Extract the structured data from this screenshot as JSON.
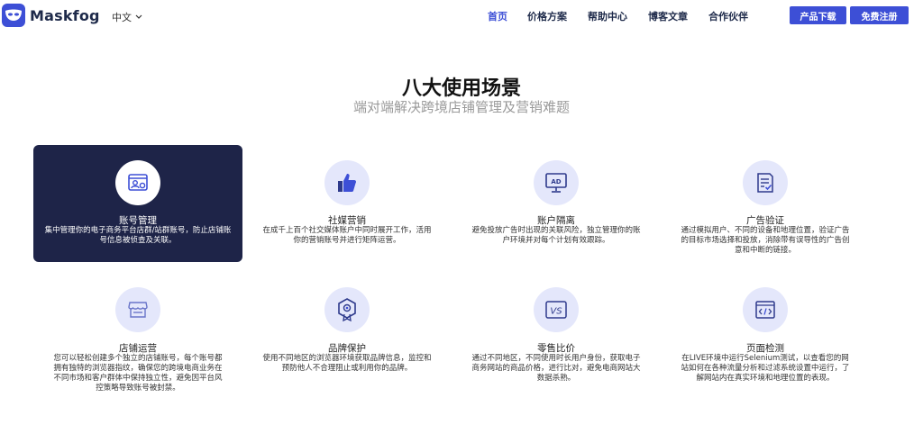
{
  "header": {
    "brand": "Maskfog",
    "language": "中文",
    "nav": [
      "首页",
      "价格方案",
      "帮助中心",
      "博客文章",
      "合作伙伴"
    ],
    "download_button": "产品下载",
    "register_button": "免费注册",
    "accent_color": "#3d4fd6"
  },
  "section": {
    "title": "八大使用场景",
    "subtitle": "端对端解决跨境店铺管理及营销难题"
  },
  "cards": [
    {
      "icon": "account-icon",
      "title": "账号管理",
      "desc": "集中管理你的电子商务平台店群/站群账号，防止店铺账号信息被侦查及关联。",
      "selected": true
    },
    {
      "icon": "thumbs-up-icon",
      "title": "社媒营销",
      "desc": "在成千上百个社交媒体账户中同时展开工作，活用你的营销账号并进行矩阵运营。",
      "selected": false
    },
    {
      "icon": "ad-monitor-icon",
      "title": "账户隔离",
      "desc": "避免投放广告时出现的关联风险，独立管理你的账户环境并对每个计划有效跟踪。",
      "selected": false
    },
    {
      "icon": "checklist-icon",
      "title": "广告验证",
      "desc": "通过模拟用户、不同的设备和地理位置，验证广告的目标市场选择和投放，消除带有误导性的广告创意和中断的链接。",
      "selected": false
    },
    {
      "icon": "store-icon",
      "title": "店铺运营",
      "desc": "您可以轻松创建多个独立的店铺账号，每个账号都拥有独特的浏览器指纹，确保您的跨境电商业务在不同市场和客户群体中保持独立性，避免因平台风控策略导致账号被封禁。",
      "selected": false
    },
    {
      "icon": "badge-icon",
      "title": "品牌保护",
      "desc": "使用不同地区的浏览器环境获取品牌信息，监控和预防他人不合理阻止或利用你的品牌。",
      "selected": false
    },
    {
      "icon": "vs-icon",
      "title": "零售比价",
      "desc": "通过不同地区，不同使用时长用户身份，获取电子商务网站的商品价格，进行比对，避免电商网站大数据杀熟。",
      "selected": false
    },
    {
      "icon": "code-window-icon",
      "title": "页面检测",
      "desc": "在LIVE环境中运行Selenium测试，以查看您的网站如何在各种流量分析和过滤系统设置中运行，了解网站内在真实环境和地理位置的表现。",
      "selected": false
    }
  ]
}
